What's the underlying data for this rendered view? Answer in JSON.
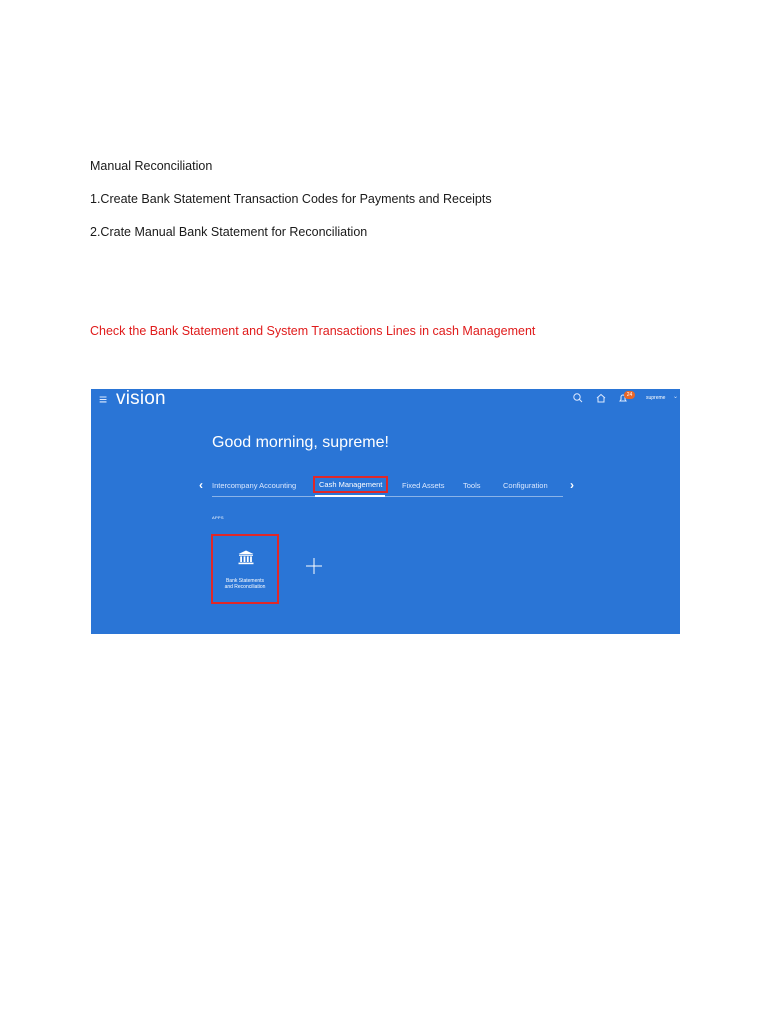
{
  "document": {
    "heading": "Manual Reconciliation",
    "step_1": "1.Create Bank Statement Transaction Codes for Payments and Receipts",
    "step_2": "2.Crate Manual Bank Statement for Reconciliation",
    "note": "Check  the Bank Statement and System Transactions Lines in   cash Management",
    "note_color": "#e01b1b"
  },
  "screenshot": {
    "background_color": "#2a75d6",
    "highlight_color": "#e12828",
    "brand": "vision",
    "menu_icon": "hamburger-icon",
    "header_icons": [
      "search-icon",
      "home-icon",
      "notifications-icon"
    ],
    "notification_count": "24",
    "user_name": "supreme",
    "greeting": "Good morning, supreme!",
    "tabs": [
      {
        "label": "Intercompany Accounting",
        "active": false
      },
      {
        "label": "Cash Management",
        "active": true
      },
      {
        "label": "Fixed Assets",
        "active": false
      },
      {
        "label": "Tools",
        "active": false
      },
      {
        "label": "Configuration",
        "active": false
      }
    ],
    "section_label": "APPS",
    "app_tile": {
      "icon": "bank-icon",
      "label_line_1": "Bank Statements",
      "label_line_2": "and Reconciliation"
    },
    "add_tile_icon": "plus-icon"
  }
}
